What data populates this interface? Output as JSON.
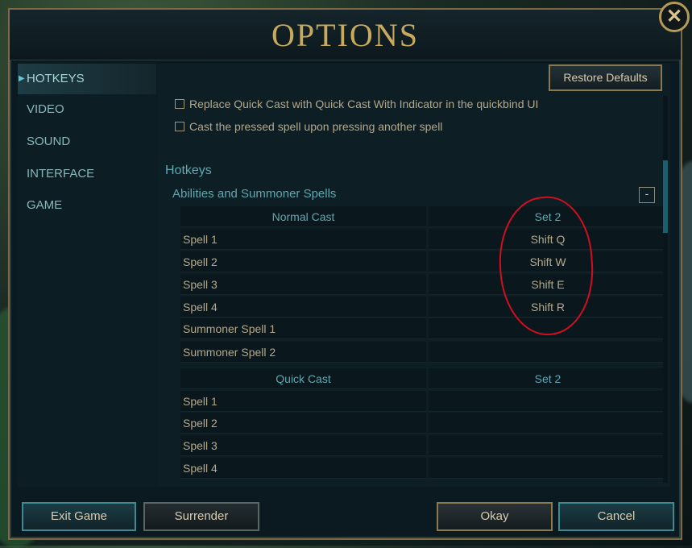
{
  "window": {
    "title": "OPTIONS",
    "close_symbol": "✕"
  },
  "sidebar": {
    "items": [
      {
        "label": "HOTKEYS",
        "active": true
      },
      {
        "label": "VIDEO"
      },
      {
        "label": "SOUND"
      },
      {
        "label": "INTERFACE"
      },
      {
        "label": "GAME"
      }
    ]
  },
  "toolbar": {
    "restore_label": "Restore Defaults"
  },
  "options": [
    {
      "label": "Replace Quick Cast with Quick Cast With Indicator in the quickbind UI",
      "checked": false
    },
    {
      "label": "Cast the pressed spell upon pressing another spell",
      "checked": false
    }
  ],
  "hotkeys": {
    "section_title": "Hotkeys",
    "subsection_title": "Abilities and Summoner Spells",
    "collapse_label": "-",
    "normal_cast": {
      "header": [
        "Normal Cast",
        "Set 2"
      ],
      "rows": [
        [
          "Spell 1",
          "Shift Q"
        ],
        [
          "Spell 2",
          "Shift W"
        ],
        [
          "Spell 3",
          "Shift E"
        ],
        [
          "Spell 4",
          "Shift R"
        ],
        [
          "Summoner Spell 1",
          ""
        ],
        [
          "Summoner Spell 2",
          ""
        ]
      ]
    },
    "quick_cast": {
      "header": [
        "Quick Cast",
        "Set 2"
      ],
      "rows": [
        [
          "Spell 1",
          ""
        ],
        [
          "Spell 2",
          ""
        ],
        [
          "Spell 3",
          ""
        ],
        [
          "Spell 4",
          ""
        ]
      ]
    }
  },
  "footer": {
    "exit_label": "Exit Game",
    "surrender_label": "Surrender",
    "okay_label": "Okay",
    "cancel_label": "Cancel"
  },
  "colors": {
    "accent": "#5ea8b1",
    "gold": "#c9a95c",
    "annotation": "#d10f1f"
  }
}
